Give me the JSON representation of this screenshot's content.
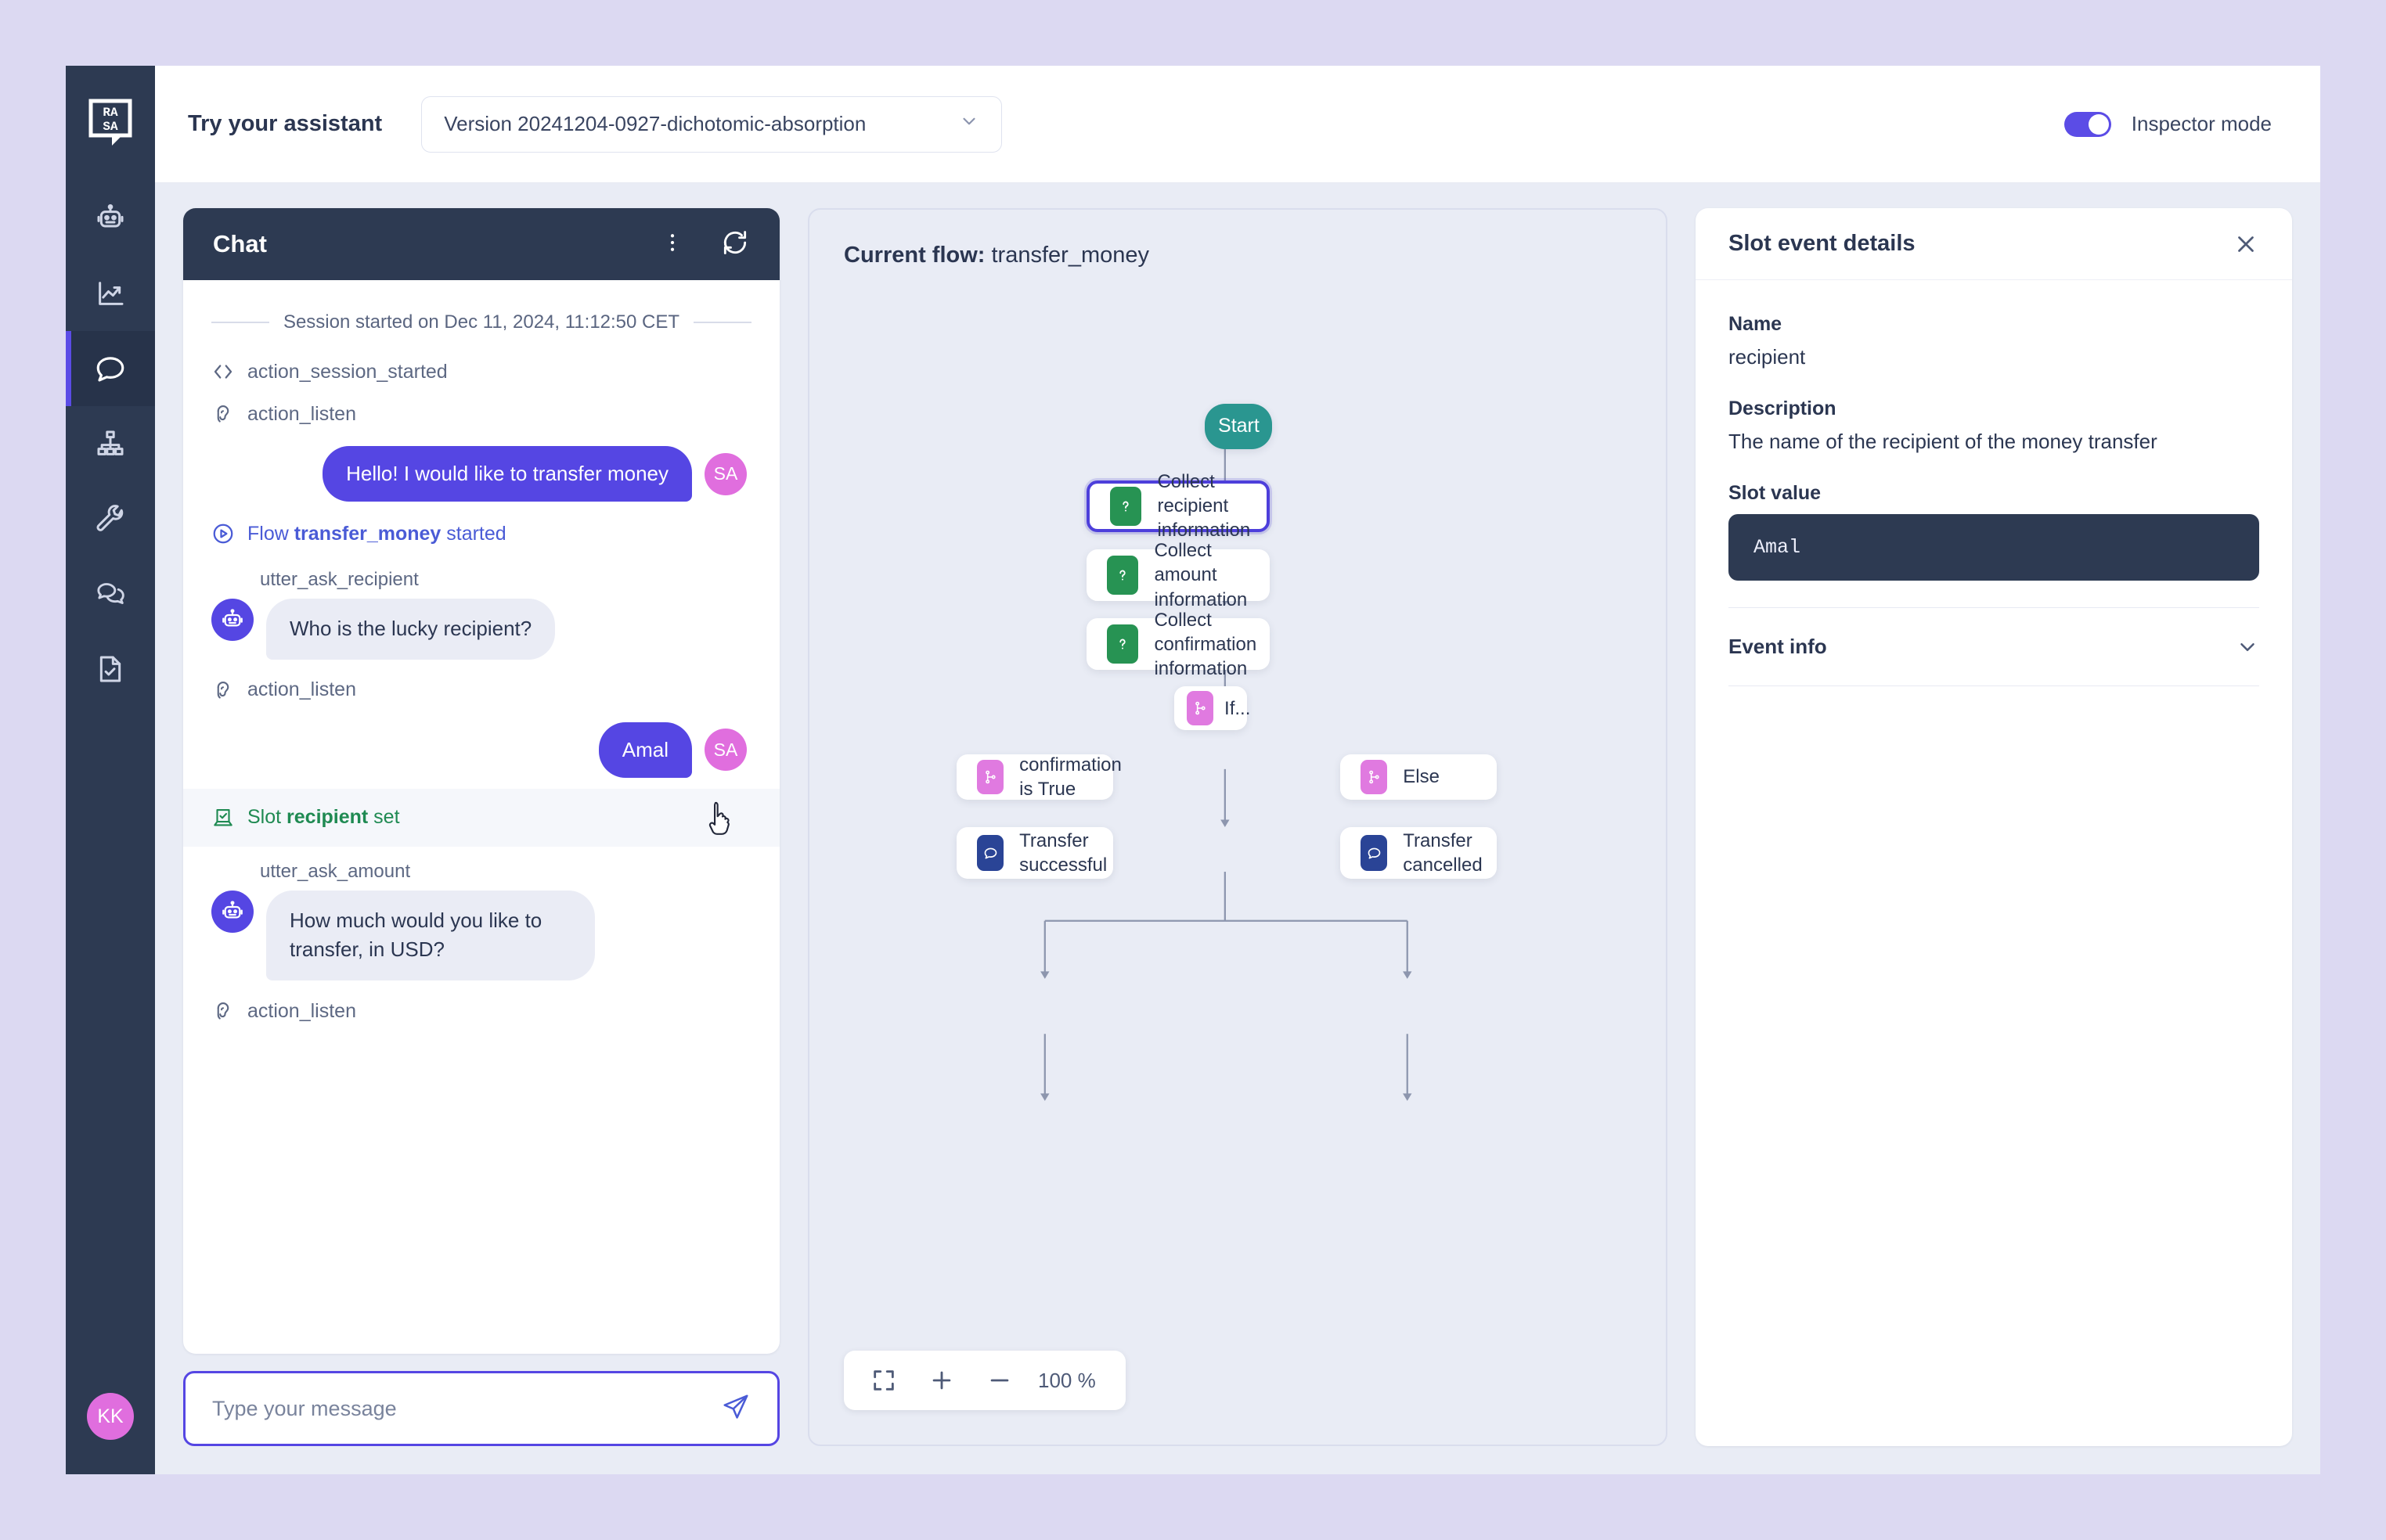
{
  "topbar": {
    "title": "Try your assistant",
    "version_value": "Version 20241204-0927-dichotomic-absorption",
    "inspector_label": "Inspector mode"
  },
  "sidebar": {
    "logo": "rasa-logo",
    "items": [
      {
        "name": "assistant",
        "icon": "robot-icon"
      },
      {
        "name": "analytics",
        "icon": "chart-trend-icon"
      },
      {
        "name": "talk-to-assistant",
        "icon": "chat-bubble-icon",
        "active": true
      },
      {
        "name": "flows",
        "icon": "org-chart-icon"
      },
      {
        "name": "tools",
        "icon": "wrench-icon"
      },
      {
        "name": "conversations",
        "icon": "double-chat-bubble-icon"
      },
      {
        "name": "tests",
        "icon": "document-check-icon"
      }
    ],
    "avatar_initials": "KK"
  },
  "chat": {
    "title": "Chat",
    "menu_icon": "kebab-menu-icon",
    "refresh_icon": "refresh-icon",
    "session_divider": "Session started on Dec 11, 2024, 11:12:50 CET",
    "events": [
      {
        "type": "action",
        "icon": "code-icon",
        "text": "action_session_started"
      },
      {
        "type": "action",
        "icon": "ear-icon",
        "text": "action_listen"
      },
      {
        "type": "user",
        "text": "Hello! I would like to transfer money",
        "avatar": "SA"
      },
      {
        "type": "flow",
        "icon": "play-circle-icon",
        "pre": "Flow ",
        "bold": "transfer_money",
        "post": " started"
      },
      {
        "type": "bot",
        "utter": "utter_ask_recipient",
        "text": "Who is the lucky recipient?"
      },
      {
        "type": "action",
        "icon": "ear-icon",
        "text": "action_listen"
      },
      {
        "type": "user",
        "text": "Amal",
        "avatar": "SA"
      },
      {
        "type": "slot",
        "icon": "slot-icon",
        "pre": "Slot ",
        "bold": "recipient",
        "post": " set",
        "highlighted": true
      },
      {
        "type": "bot",
        "utter": "utter_ask_amount",
        "text": "How much would you like to transfer, in USD?"
      },
      {
        "type": "action",
        "icon": "ear-icon",
        "text": "action_listen"
      }
    ],
    "composer_placeholder": "Type your message",
    "send_icon": "send-icon"
  },
  "flow": {
    "title_prefix": "Current flow: ",
    "title_name": "transfer_money",
    "nodes": {
      "start": "Start",
      "collect_recipient": "Collect recipient information",
      "collect_amount": "Collect amount information",
      "collect_confirmation": "Collect confirmation information",
      "if": "If...",
      "branch_true": "confirmation is True",
      "branch_else": "Else",
      "success": "Transfer successful",
      "cancelled": "Transfer cancelled"
    },
    "zoom": {
      "fit_icon": "fit-screen-icon",
      "plus_icon": "zoom-in-icon",
      "minus_icon": "zoom-out-icon",
      "level": "100 %"
    }
  },
  "inspector": {
    "title": "Slot event details",
    "close_icon": "close-icon",
    "name_label": "Name",
    "name_value": "recipient",
    "description_label": "Description",
    "description_value": "The name of the recipient of the money transfer",
    "slot_value_label": "Slot value",
    "slot_value": "Amal",
    "event_info_label": "Event info",
    "event_info_icon": "chevron-down-icon"
  },
  "colors": {
    "page_bg": "#dcd9f2",
    "sidebar": "#2d3a52",
    "accent_purple": "#5546e3",
    "user_bubble": "#5546e3",
    "bot_bubble": "#eaecf5",
    "avatar_pink": "#e06ede",
    "start_teal": "#2a9690",
    "collect_green": "#279353",
    "branch_pink": "#e07ae0",
    "message_blue": "#2a4496",
    "slot_green": "#1f8a52",
    "flow_link_blue": "#4a5bd6"
  }
}
